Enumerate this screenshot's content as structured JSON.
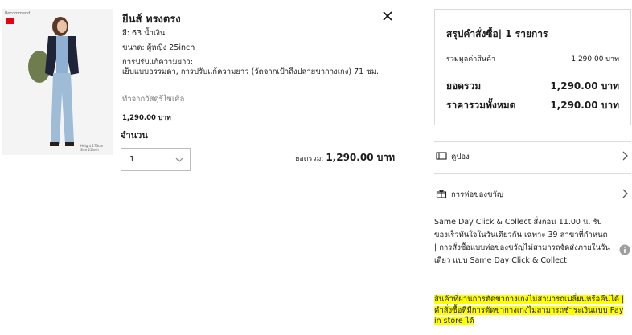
{
  "product": {
    "brand_tag": "Recommend",
    "image_caption": "Height 173cm Size 25inch",
    "name": "ยีนส์ ทรงตรง",
    "color": "สี: 63 น้ำเงิน",
    "size": "ขนาด: ผู้หญิง 25inch",
    "alteration_label": "การปรับแก้ความยาว:",
    "alteration_detail": "เย็บแบบธรรมดา, การปรับแก้ความยาว (วัดจากเป้าถึงปลายขากางเกง) 71 ซม.",
    "eco": "ทำจากวัสดุรีไซเคิล",
    "price": "1,290.00 บาท",
    "quantity_label": "จำนวน",
    "quantity_value": "1",
    "subtotal_label": "ยอดรวม:",
    "subtotal_value": "1,290.00 บาท"
  },
  "summary": {
    "title": "สรุปคำสั่งซื้อ| 1 รายการ",
    "items_label": "รวมมูลค่าสินค้า",
    "items_value": "1,290.00 บาท",
    "total_label": "ยอดรวม",
    "total_value": "1,290.00 บาท",
    "grand_label": "ราคารวมทั้งหมด",
    "grand_value": "1,290.00 บาท"
  },
  "coupon": {
    "label": "คูปอง",
    "icon": "ticket-icon"
  },
  "gift": {
    "label": "การห่อของขวัญ",
    "icon": "gift-icon"
  },
  "info_text": "Same Day Click & Collect สั่งก่อน 11.00 น. รับของเร็วทันใจในวันเดียวกัน เฉพาะ 39 สาขาที่กำหนด | การสั่งซื้อแบบห่อของขวัญไม่สามารถจัดส่งภายในวันเดียว แบบ Same Day Click & Collect",
  "notice": "สินค้าที่ผ่านการตัดขากางเกงไม่สามารถเปลี่ยนหรือคืนได้ | คำสั่งซื้อที่มีการตัดขากางเกงไม่สามารถชำระเงินแบบ Pay in store ได้",
  "colors": {
    "highlight": "#ffff00",
    "brand": "#e60012",
    "border": "#dadada"
  }
}
